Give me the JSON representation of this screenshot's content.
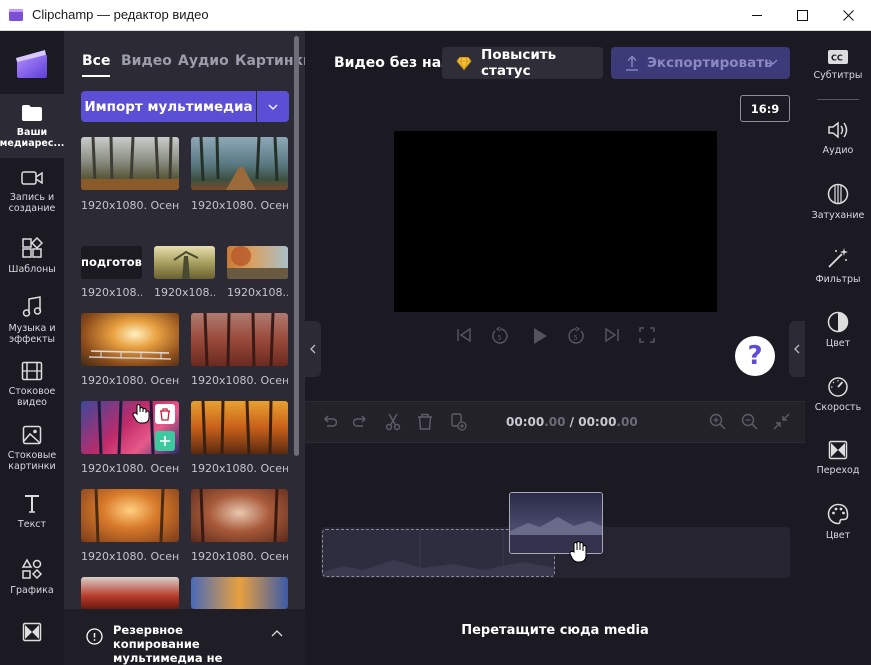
{
  "window": {
    "title": "Clipchamp — редактор видео",
    "controls": [
      "minimize-icon",
      "maximize-icon",
      "close-icon"
    ]
  },
  "left_nav": {
    "items": [
      {
        "label": "Ваши\nмедиарес...",
        "icon": "folder-icon",
        "active": true
      },
      {
        "label": "Запись и\nсоздание",
        "icon": "camera-icon"
      },
      {
        "label": "Шаблоны",
        "icon": "templates-icon"
      },
      {
        "label": "Музыка и\nэффекты",
        "icon": "music-icon"
      },
      {
        "label": "Стоковое\nвидео",
        "icon": "film-icon"
      },
      {
        "label": "Стоковые\nкартинки",
        "icon": "image-icon"
      },
      {
        "label": "Текст",
        "icon": "text-icon"
      },
      {
        "label": "Графика",
        "icon": "shapes-icon"
      }
    ]
  },
  "media_panel": {
    "tabs": [
      "Все",
      "Видео",
      "Аудио",
      "Картинки"
    ],
    "active_tab": "Все",
    "import_label": "Импорт мультимедиа",
    "items": [
      {
        "caption": "1920x1080. Осен..."
      },
      {
        "caption": "1920x1080. Осен..."
      },
      {
        "caption": "1920x108...",
        "overlay_text": "подготовка"
      },
      {
        "caption": "1920x108..."
      },
      {
        "caption": "1920x108..."
      },
      {
        "caption": "1920x1080. Осен..."
      },
      {
        "caption": "1920x1080. Осен..."
      },
      {
        "caption": "1920x1080. Осен..."
      },
      {
        "caption": "1920x1080. Осен..."
      },
      {
        "caption": "1920x1080. Осен..."
      },
      {
        "caption": "1920x1080. Осен..."
      }
    ],
    "backup_text": "Резервное копирование мультимедиа не выполнено"
  },
  "center": {
    "project_title": "Видео без назв",
    "upgrade_label": "Повысить статус",
    "export_label": "Экспортировать",
    "aspect_ratio": "16:9",
    "help_label": "?",
    "timecode_current_main": "00:00",
    "timecode_current_frac": ".00",
    "timecode_sep": " / ",
    "timecode_total_main": "00:00",
    "timecode_total_frac": ".00",
    "drop_hint": "Перетащите сюда media"
  },
  "right_nav": {
    "items": [
      {
        "label": "Субтитры",
        "icon": "captions-icon"
      },
      {
        "label": "Аудио",
        "icon": "volume-icon"
      },
      {
        "label": "Затухание",
        "icon": "fade-icon"
      },
      {
        "label": "Фильтры",
        "icon": "magic-wand-icon"
      },
      {
        "label": "Цвет",
        "icon": "color-adjust-icon"
      },
      {
        "label": "Скорость",
        "icon": "speedometer-icon"
      },
      {
        "label": "Переход",
        "icon": "transition-icon"
      },
      {
        "label": "Цвет",
        "icon": "palette-icon"
      }
    ]
  },
  "colors": {
    "accent": "#5b4fd6",
    "add_green": "#3cc9a0"
  }
}
